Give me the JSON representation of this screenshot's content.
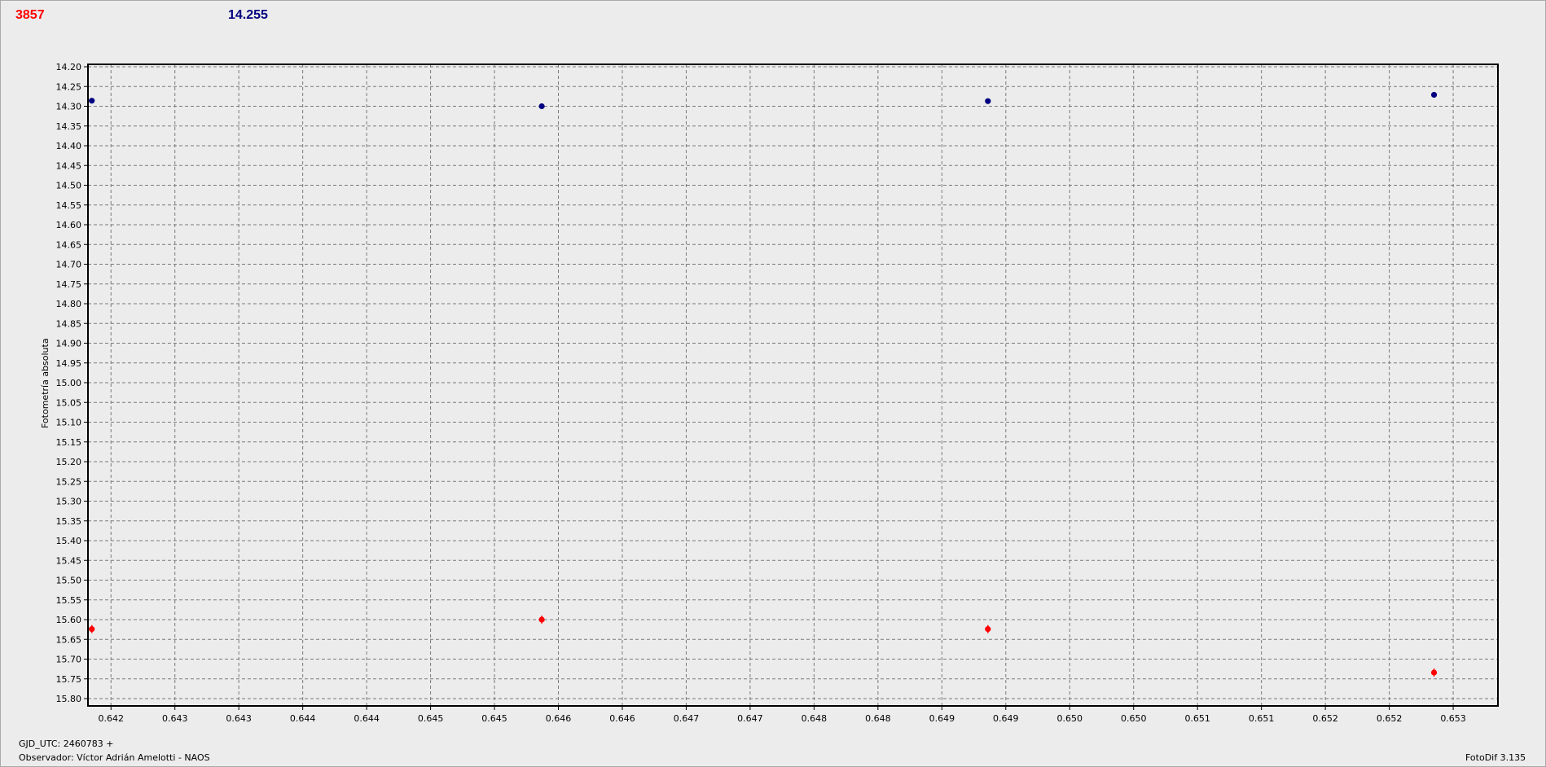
{
  "header": {
    "series1_value": "3857",
    "series2_value": "14.255"
  },
  "footer": {
    "gjd": "GJD_UTC: 2460783 +",
    "observer": "Observador: Víctor Adrián Amelotti - NAOS",
    "software": "FotoDif 3.135"
  },
  "colors": {
    "series1": "#ff0000",
    "series2": "#000080",
    "grid": "#7a7a7a",
    "plot_background": "#ececec"
  },
  "chart_data": {
    "type": "scatter",
    "title": "",
    "xlabel": "",
    "ylabel": "Fotometría absoluta",
    "y_inverted": true,
    "ylim": [
      14.2,
      15.8
    ],
    "xlim": [
      0.64182,
      0.65285
    ],
    "grid": true,
    "legend": "none",
    "x_tick_values": [
      0.642,
      0.6425,
      0.643,
      0.6435,
      0.644,
      0.6445,
      0.645,
      0.6455,
      0.646,
      0.6465,
      0.647,
      0.6475,
      0.648,
      0.6485,
      0.649,
      0.6495,
      0.65,
      0.6505,
      0.651,
      0.6515,
      0.652,
      0.6525
    ],
    "x_tick_labels": [
      "0.642",
      "0.643",
      "0.643",
      "0.644",
      "0.644",
      "0.645",
      "0.645",
      "0.646",
      "0.646",
      "0.647",
      "0.647",
      "0.648",
      "0.648",
      "0.649",
      "0.649",
      "0.650",
      "0.650",
      "0.651",
      "0.651",
      "0.652",
      "0.652",
      "0.653"
    ],
    "y_tick_labels": [
      "14.20",
      "14.25",
      "14.30",
      "14.35",
      "14.40",
      "14.45",
      "14.50",
      "14.55",
      "14.60",
      "14.65",
      "14.70",
      "14.75",
      "14.80",
      "14.85",
      "14.90",
      "14.95",
      "15.00",
      "15.05",
      "15.10",
      "15.15",
      "15.20",
      "15.25",
      "15.30",
      "15.35",
      "15.40",
      "15.45",
      "15.50",
      "15.55",
      "15.60",
      "15.65",
      "15.70",
      "15.75",
      "15.80"
    ],
    "series": [
      {
        "color": "#ff0000",
        "x": [
          0.64185,
          0.64537,
          0.64886,
          0.65235
        ],
        "y": [
          15.624,
          15.6,
          15.624,
          15.734
        ],
        "error": [
          0.01,
          0.01,
          0.01,
          0.01
        ]
      },
      {
        "color": "#000080",
        "x": [
          0.64185,
          0.64537,
          0.64886,
          0.65235
        ],
        "y": [
          14.286,
          14.3,
          14.287,
          14.271
        ],
        "error": [
          0.005,
          0.005,
          0.005,
          0.005
        ]
      }
    ]
  }
}
